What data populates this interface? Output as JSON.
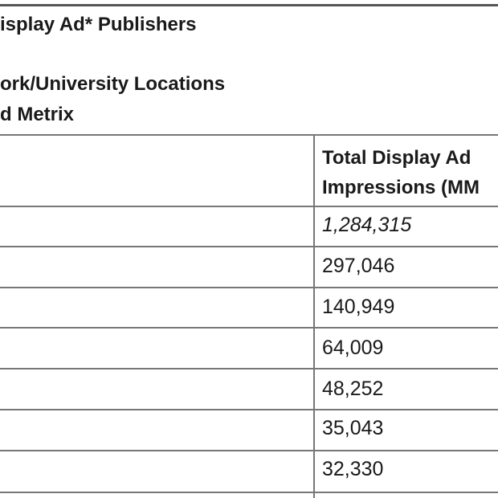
{
  "title": "isplay Ad* Publishers",
  "subtitle": "ork/University Locations",
  "source": "d Metrix",
  "table": {
    "header": [
      "Total Display Ad",
      "Impressions (MM"
    ],
    "rows": [
      {
        "value": "1,284,315"
      },
      {
        "value": "297,046"
      },
      {
        "value": "140,949"
      },
      {
        "value": "64,009"
      },
      {
        "value": "48,252"
      },
      {
        "value": "35,043"
      },
      {
        "value": "32,330"
      }
    ]
  }
}
